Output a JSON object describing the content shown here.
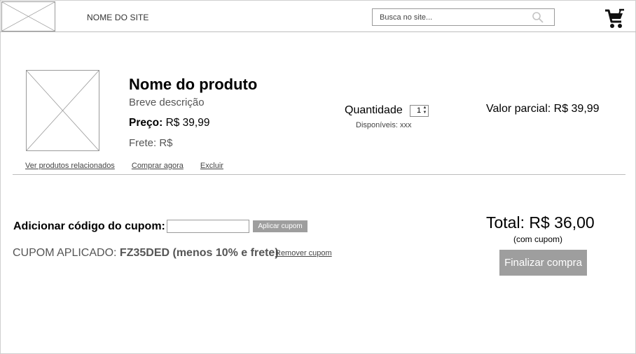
{
  "header": {
    "site_name": "NOME DO SITE",
    "search_placeholder": "Busca no site...",
    "search_icon": "search-icon",
    "cart_icon": "cart-icon"
  },
  "product": {
    "name": "Nome do produto",
    "description": "Breve descrição",
    "price_label": "Preço:",
    "price_value": "R$ 39,99",
    "freight": "Frete: R$",
    "quantity_label": "Quantidade",
    "quantity_value": "1",
    "available": "Disponíveis: xxx",
    "partial": "Valor parcial: R$ 39,99",
    "links": {
      "related": "Ver produtos relacionados",
      "buy_now": "Comprar agora",
      "delete": "Excluir"
    }
  },
  "coupon": {
    "label": "Adicionar código do cupom:",
    "apply_button": "Aplicar cupom",
    "applied_prefix": "CUPOM APLICADO: ",
    "applied_code": "FZ35DED (menos 10% e frete)",
    "remove_link": "Remover cupom"
  },
  "summary": {
    "total": "Total: R$ 36,00",
    "total_note": "(com cupom)",
    "finish_button": "Finalizar compra"
  },
  "colors": {
    "button_gray": "#9e9e9e",
    "border_gray": "#9a9a9a",
    "divider": "#bdbdbd"
  }
}
